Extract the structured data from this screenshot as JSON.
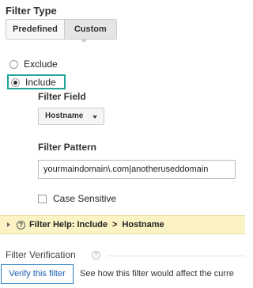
{
  "filter_type": {
    "title": "Filter Type",
    "tabs": [
      {
        "label": "Predefined",
        "selected": false
      },
      {
        "label": "Custom",
        "selected": true
      }
    ]
  },
  "options": {
    "exclude_label": "Exclude",
    "include_label": "Include",
    "selected": "Include"
  },
  "filter_field": {
    "label": "Filter Field",
    "value": "Hostname"
  },
  "filter_pattern": {
    "label": "Filter Pattern",
    "value": "yourmaindomain\\.com|anotheruseddomain"
  },
  "case_sensitive": {
    "label": "Case Sensitive",
    "checked": false
  },
  "help": {
    "prefix": "Filter Help: Include",
    "arrow": ">",
    "field": "Hostname",
    "qmark": "?"
  },
  "verification": {
    "title": "Filter Verification",
    "qmark": "?",
    "button_label": "Verify this filter",
    "description": "See how this filter would affect the curre"
  },
  "colors": {
    "include_highlight": "#1fa59a",
    "help_bar_bg": "#fcf3c4",
    "verify_button_border": "#2a7fc1",
    "link_text": "#1a5fb4"
  }
}
